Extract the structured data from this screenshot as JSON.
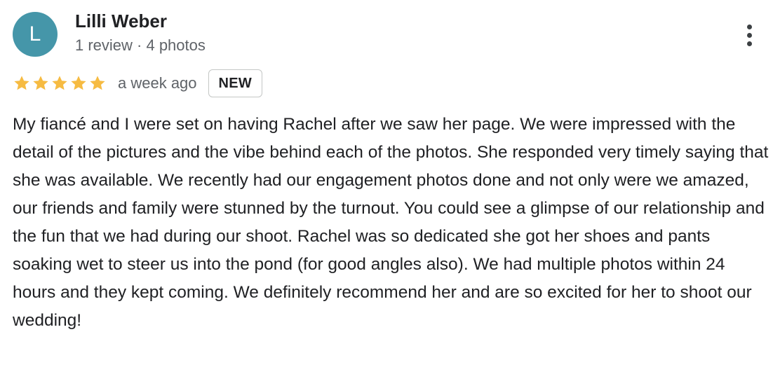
{
  "review": {
    "author": {
      "initial": "L",
      "name": "Lilli Weber",
      "meta": "1 review · 4 photos",
      "avatar_color": "#4596a9"
    },
    "rating": {
      "stars": 5,
      "max": 5,
      "star_color": "#f6bb42"
    },
    "time": "a week ago",
    "badge": "NEW",
    "more_icon": "more-vertical-icon",
    "text": "My fiancé and I were set on having Rachel after we saw her page. We were impressed with the detail of the pictures and the vibe behind each of the photos. She responded very timely saying that she was available. We recently had our engagement photos done and not only were we amazed, our friends and family were stunned by the turnout. You could see a glimpse of our relationship and the fun that we had during our shoot. Rachel was so dedicated she got her shoes and pants soaking wet to steer us into the pond (for good angles also). We had multiple photos within 24 hours and they kept coming. We definitely recommend her and are so excited for her to shoot our wedding!"
  }
}
